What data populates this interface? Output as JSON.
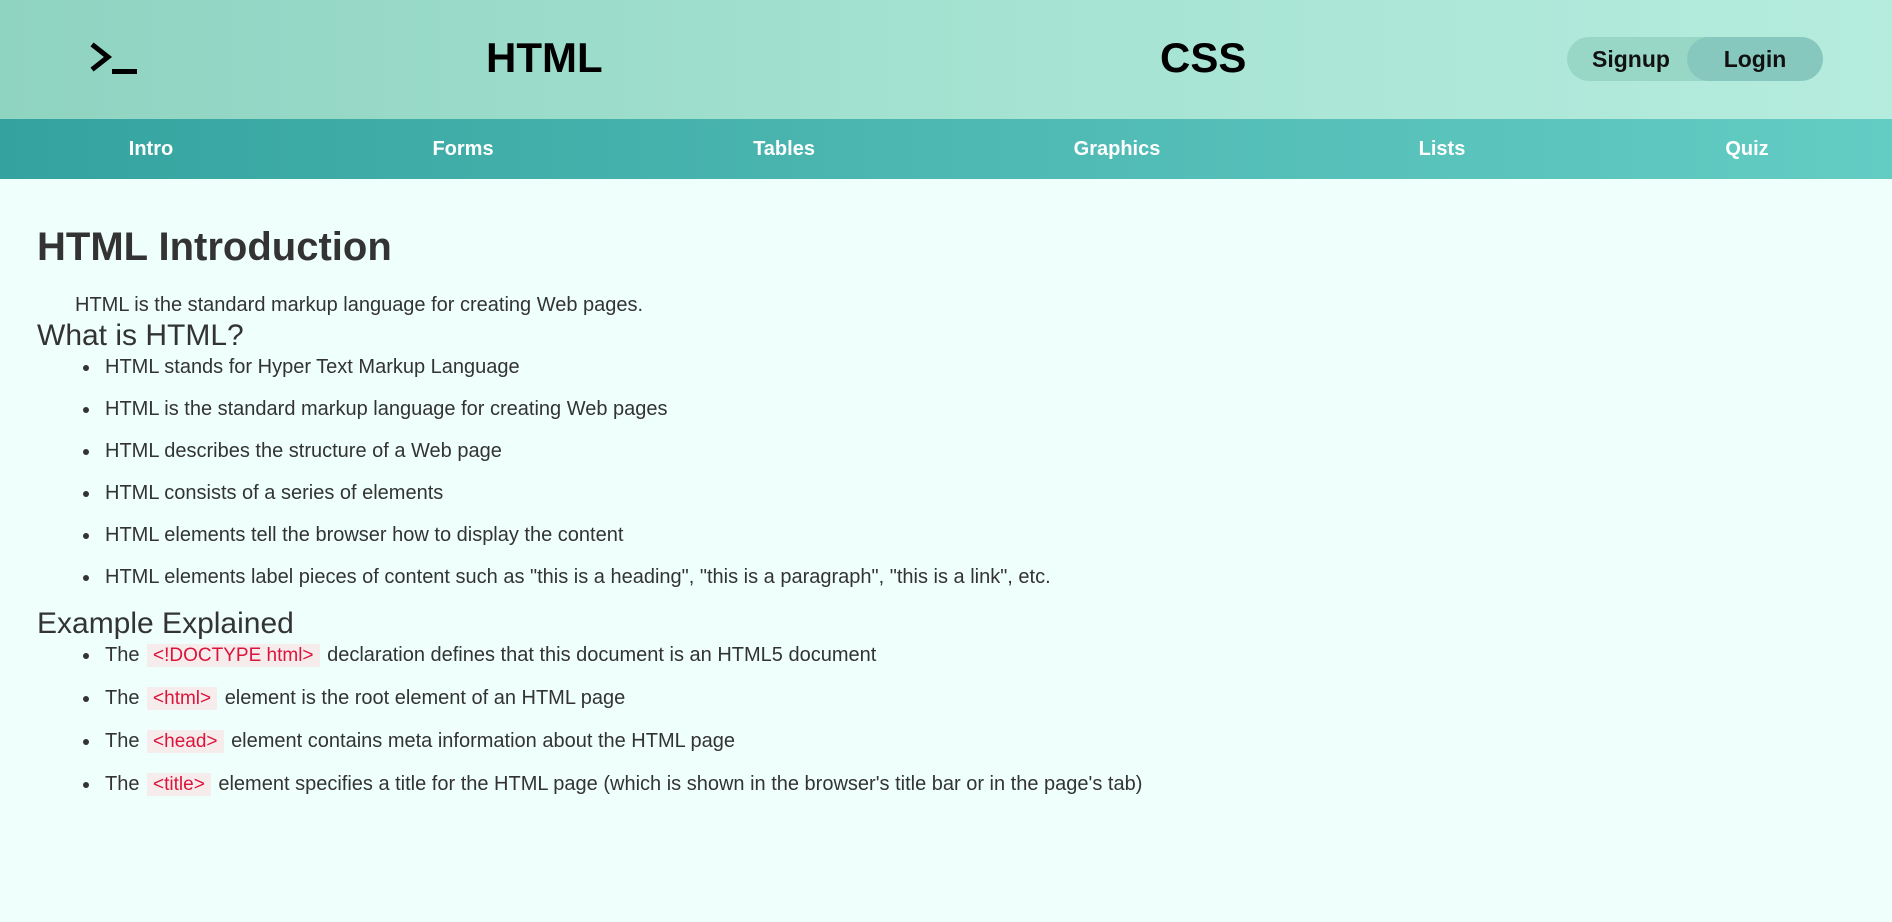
{
  "header": {
    "logo_icon": "terminal-prompt-icon",
    "brand_html": "HTML",
    "brand_css": "CSS",
    "signup_label": "Signup",
    "login_label": "Login"
  },
  "nav": {
    "items": [
      {
        "label": "Intro"
      },
      {
        "label": "Forms"
      },
      {
        "label": "Tables"
      },
      {
        "label": "Graphics"
      },
      {
        "label": "Lists"
      },
      {
        "label": "Quiz"
      }
    ]
  },
  "main": {
    "title": "HTML Introduction",
    "intro": "HTML is the standard markup language for creating Web pages.",
    "what_heading": "What is HTML?",
    "what_items": [
      "HTML stands for Hyper Text Markup Language",
      "HTML is the standard markup language for creating Web pages",
      "HTML describes the structure of a Web page",
      "HTML consists of a series of elements",
      "HTML elements tell the browser how to display the content",
      "HTML elements label pieces of content such as \"this is a heading\", \"this is a paragraph\", \"this is a link\", etc."
    ],
    "example_heading": "Example Explained",
    "example_items": [
      {
        "prefix": "The",
        "code": "<!DOCTYPE html>",
        "text": "declaration defines that this document is an HTML5 document"
      },
      {
        "prefix": "The",
        "code": "<html>",
        "text": "element is the root element of an HTML page"
      },
      {
        "prefix": "The",
        "code": "<head>",
        "text": "element contains meta information about the HTML page"
      },
      {
        "prefix": "The",
        "code": "<title>",
        "text": "element specifies a title for the HTML page (which is shown in the browser's title bar or in the page's tab)"
      }
    ]
  },
  "colors": {
    "header_gradient_start": "#8fd3c1",
    "header_gradient_end": "#b5ecde",
    "nav_gradient_start": "#34a39f",
    "nav_gradient_end": "#63cdc4",
    "page_background": "#effffb",
    "code_text": "#dc143c"
  }
}
